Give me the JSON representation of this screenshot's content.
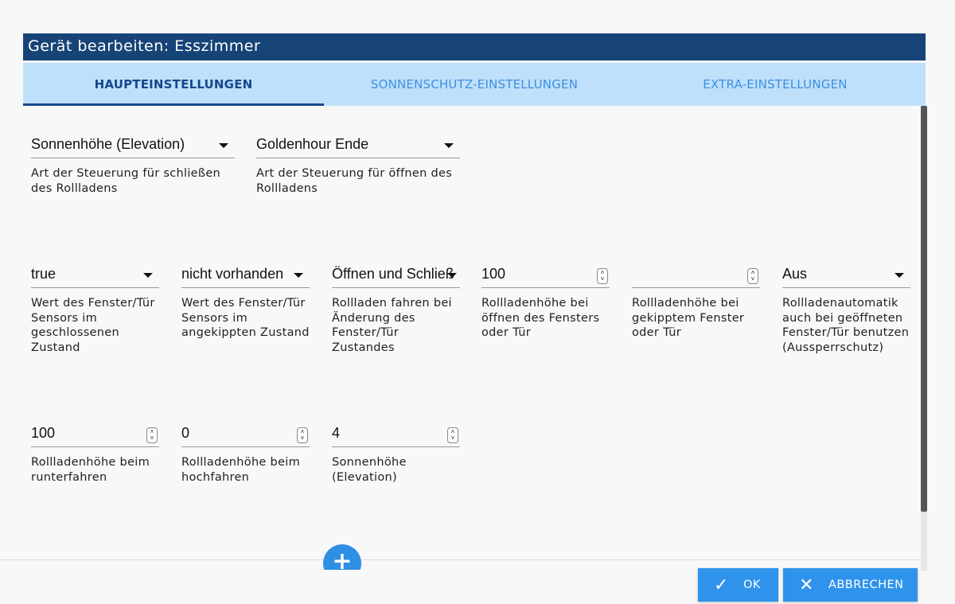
{
  "dialog": {
    "title": "Gerät bearbeiten: Esszimmer"
  },
  "tabs": [
    {
      "label": "HAUPTEINSTELLUNGEN"
    },
    {
      "label": "SONNENSCHUTZ-EINSTELLUNGEN"
    },
    {
      "label": "EXTRA-EINSTELLUNGEN"
    }
  ],
  "row1": [
    {
      "value": "Sonnenhöhe (Elevation)",
      "help": "Art der Steuerung für schließen des Rollladens"
    },
    {
      "value": "Goldenhour Ende",
      "help": "Art der Steuerung für öffnen des Rollladens"
    }
  ],
  "row2": [
    {
      "value": "true",
      "help": "Wert des Fenster/Tür Sensors im geschlossenen Zustand"
    },
    {
      "value": "nicht vorhanden",
      "help": "Wert des Fenster/Tür Sensors im angekippten Zustand"
    },
    {
      "value": "Öffnen und Schließ",
      "help": "Rollladen fahren bei Änderung des Fenster/Tür Zustandes"
    },
    {
      "value": "100",
      "help": "Rollladenhöhe bei öffnen des Fensters oder Tür"
    },
    {
      "value": "",
      "help": "Rollladenhöhe bei gekipptem Fenster oder Tür"
    },
    {
      "value": "Aus",
      "help": "Rollladenautomatik auch bei geöffneten Fenster/Tür benutzen (Aussperrschutz)"
    }
  ],
  "row3": [
    {
      "value": "100",
      "help": "Rollladenhöhe beim runterfahren"
    },
    {
      "value": "0",
      "help": "Rollladenhöhe beim hochfahren"
    },
    {
      "value": "4",
      "help": "Sonnenhöhe (Elevation)"
    }
  ],
  "buttons": {
    "ok": "OK",
    "cancel": "ABBRECHEN",
    "add": "+"
  },
  "icons": {
    "ok": "check-icon",
    "cancel": "close-icon",
    "add": "plus-icon",
    "select": "caret-down-icon",
    "spin": "spinner-icon"
  },
  "colors": {
    "header": "#164477",
    "tabbar": "#bee0fb",
    "tab_active": "#17478d",
    "tab_inactive": "#3e8fe0",
    "primary": "#2f93ec"
  }
}
